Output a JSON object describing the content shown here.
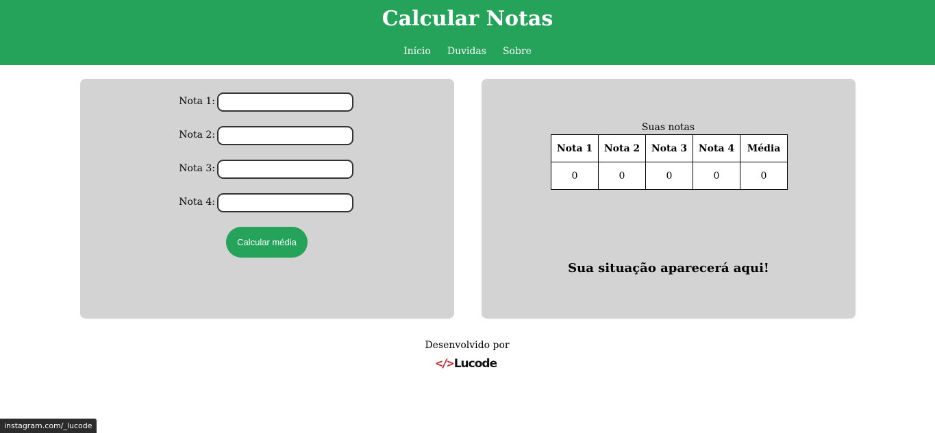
{
  "header": {
    "title": "Calcular Notas",
    "nav": [
      "Início",
      "Duvidas",
      "Sobre"
    ]
  },
  "form": {
    "fields": [
      {
        "label": "Nota 1:",
        "value": ""
      },
      {
        "label": "Nota 2:",
        "value": ""
      },
      {
        "label": "Nota 3:",
        "value": ""
      },
      {
        "label": "Nota 4:",
        "value": ""
      }
    ],
    "button_label": "Calcular média"
  },
  "results": {
    "caption": "Suas notas",
    "headers": [
      "Nota 1",
      "Nota 2",
      "Nota 3",
      "Nota 4",
      "Média"
    ],
    "values": [
      "0",
      "0",
      "0",
      "0",
      "0"
    ],
    "situacao": "Sua situação aparecerá aqui!"
  },
  "footer": {
    "text": "Desenvolvido por",
    "logo_mark": "</>",
    "logo_name": "Lucode"
  },
  "statusbar": {
    "url": "instagram.com/_lucode"
  },
  "colors": {
    "accent": "#25a35a",
    "panel": "#d3d3d3"
  }
}
